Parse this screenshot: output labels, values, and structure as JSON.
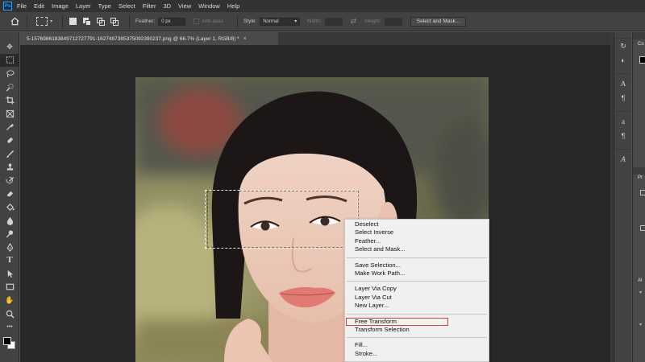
{
  "app": {
    "logo_text": "Ps",
    "accent_color": "#31a8ff"
  },
  "menubar": {
    "items": [
      "File",
      "Edit",
      "Image",
      "Layer",
      "Type",
      "Select",
      "Filter",
      "3D",
      "View",
      "Window",
      "Help"
    ]
  },
  "options_bar": {
    "feather_label": "Feather:",
    "feather_value": "0 px",
    "anti_alias_label": "Anti-alias",
    "style_label": "Style:",
    "style_value": "Normal",
    "width_label": "Width:",
    "height_label": "Height:",
    "select_mask_button": "Select and Mask..."
  },
  "document_tab": {
    "title": "5-1576986183849712727791-1627487385375092390237.png @ 66.7% (Layer 1, RGB/8) *",
    "close_glyph": "×"
  },
  "toolbar": {
    "tools": [
      "move-tool",
      "rectangular-marquee-tool",
      "lasso-tool",
      "quick-selection-tool",
      "crop-tool",
      "frame-tool",
      "eyedropper-tool",
      "healing-brush-tool",
      "brush-tool",
      "clone-stamp-tool",
      "history-brush-tool",
      "eraser-tool",
      "paint-bucket-tool",
      "blur-tool",
      "dodge-tool",
      "pen-tool",
      "type-tool",
      "path-selection-tool",
      "rectangle-tool",
      "hand-tool",
      "zoom-tool"
    ],
    "active_tool": "rectangular-marquee-tool",
    "foreground_color": "#000000",
    "background_color": "#ffffff"
  },
  "context_menu": {
    "groups": [
      [
        "Deselect",
        "Select Inverse",
        "Feather...",
        "Select and Mask..."
      ],
      [
        "Save Selection...",
        "Make Work Path..."
      ],
      [
        "Layer Via Copy",
        "Layer Via Cut",
        "New Layer..."
      ],
      [
        "Free Transform",
        "Transform Selection"
      ],
      [
        "Fill...",
        "Stroke..."
      ]
    ],
    "highlighted_item": "Free Transform",
    "highlight_color": "#e03a3a"
  },
  "right_panels": {
    "collapsed_label_1": "Co",
    "collapsed_label_2": "Pr",
    "collapsed_label_3": "Al"
  }
}
